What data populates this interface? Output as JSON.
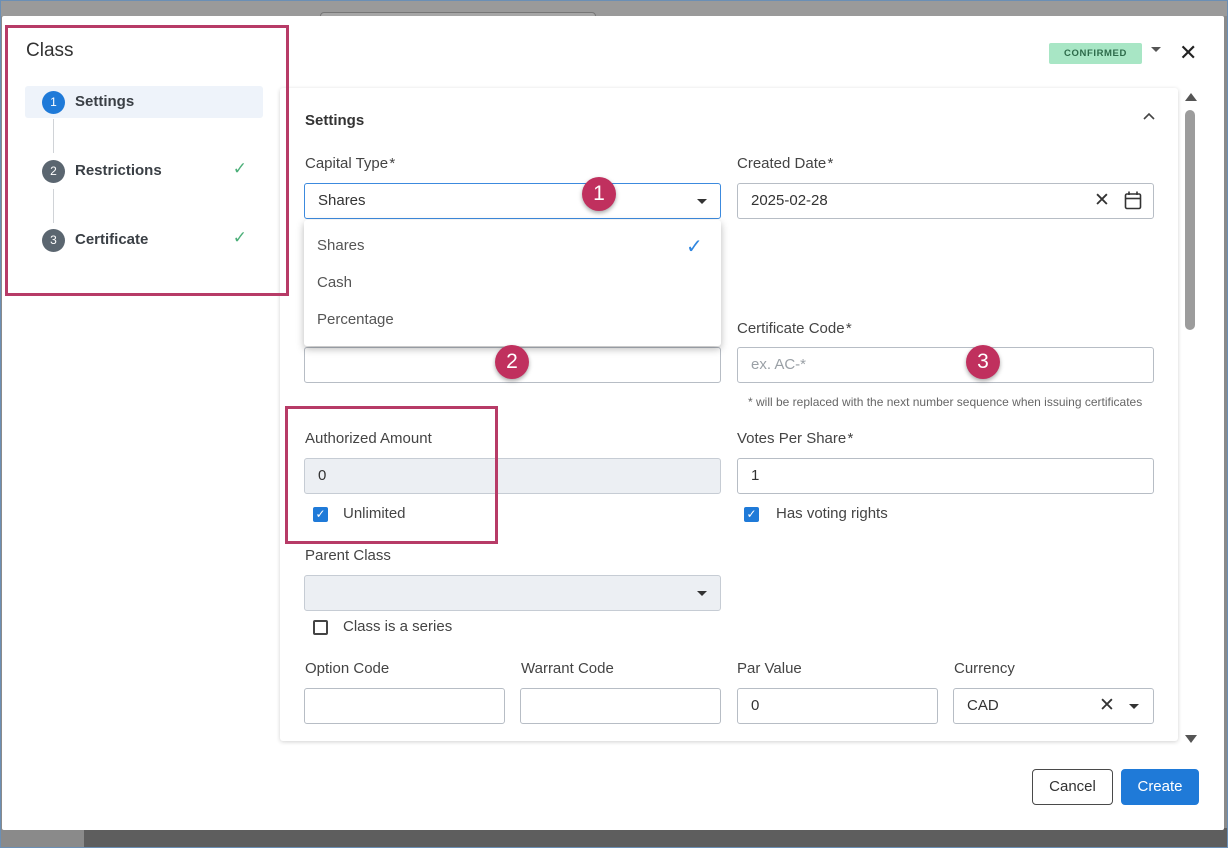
{
  "sidebar": {
    "title": "Class",
    "steps": [
      {
        "num": "1",
        "label": "Settings",
        "state": "active",
        "check": ""
      },
      {
        "num": "2",
        "label": "Restrictions",
        "state": "done",
        "check": "✓"
      },
      {
        "num": "3",
        "label": "Certificate",
        "state": "done",
        "check": "✓"
      }
    ]
  },
  "header": {
    "status": "CONFIRMED",
    "close_icon": "close-icon"
  },
  "panel": {
    "title": "Settings"
  },
  "form": {
    "capital_type": {
      "label": "Capital Type",
      "required": "*",
      "value": "Shares"
    },
    "capital_type_options": [
      {
        "label": "Shares",
        "selected": true
      },
      {
        "label": "Cash",
        "selected": false
      },
      {
        "label": "Percentage",
        "selected": false
      }
    ],
    "created_date": {
      "label": "Created Date",
      "required": "*",
      "value": "2025-02-28"
    },
    "class_name": {
      "value": ""
    },
    "certificate_code": {
      "label": "Certificate Code",
      "required": "*",
      "placeholder": "ex. AC-*",
      "hint": "* will be replaced with the next number sequence when issuing certificates"
    },
    "authorized_amount": {
      "label": "Authorized Amount",
      "value": "0"
    },
    "unlimited": {
      "label": "Unlimited",
      "checked": true
    },
    "votes_per_share": {
      "label": "Votes Per Share",
      "required": "*",
      "value": "1"
    },
    "has_voting_rights": {
      "label": "Has voting rights",
      "checked": true
    },
    "parent_class": {
      "label": "Parent Class",
      "value": ""
    },
    "class_is_series": {
      "label": "Class is a series",
      "checked": false
    },
    "option_code": {
      "label": "Option Code",
      "value": ""
    },
    "warrant_code": {
      "label": "Warrant Code",
      "value": ""
    },
    "par_value": {
      "label": "Par Value",
      "value": "0"
    },
    "currency": {
      "label": "Currency",
      "value": "CAD"
    }
  },
  "annotations": {
    "badge1": "1",
    "badge2": "2",
    "badge3": "3",
    "color": "#b73b67"
  },
  "footer": {
    "cancel_label": "Cancel",
    "create_label": "Create"
  },
  "colors": {
    "accent": "#1f7ad8",
    "status_bg": "#a8e6c5",
    "step_done": "#4caf79",
    "step_num": "#5b6670"
  }
}
